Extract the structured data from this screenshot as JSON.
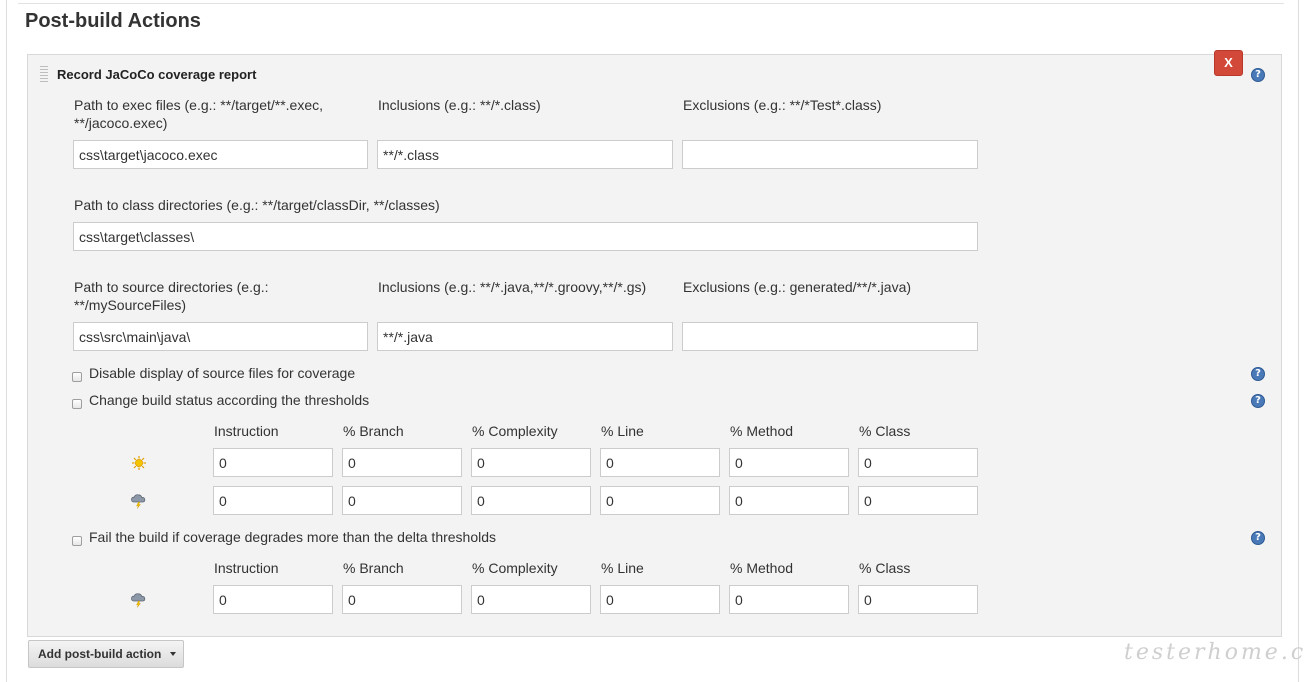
{
  "section_title": "Post-build Actions",
  "block": {
    "title": "Record JaCoCo coverage report",
    "delete_label": "X",
    "help_glyph": "?"
  },
  "exec": {
    "path_label_1": "Path to exec files (e.g.: **/target/**.exec,",
    "path_label_2": "**/jacoco.exec)",
    "path_value": "css\\target\\jacoco.exec",
    "inclusions_label": "Inclusions (e.g.: **/*.class)",
    "inclusions_value": "**/*.class",
    "exclusions_label": "Exclusions (e.g.: **/*Test*.class)",
    "exclusions_value": ""
  },
  "class_dirs": {
    "label": "Path to class directories (e.g.: **/target/classDir, **/classes)",
    "value": "css\\target\\classes\\"
  },
  "source": {
    "path_label_1": "Path to source directories (e.g.:",
    "path_label_2": "**/mySourceFiles)",
    "path_value": "css\\src\\main\\java\\",
    "inclusions_label": "Inclusions (e.g.: **/*.java,**/*.groovy,**/*.gs)",
    "inclusions_value": "**/*.java",
    "exclusions_label": "Exclusions (e.g.: generated/**/*.java)",
    "exclusions_value": ""
  },
  "options": {
    "disable_source": "Disable display of source files for coverage",
    "change_status": "Change build status according the thresholds",
    "fail_build": "Fail the build if coverage degrades more than the delta thresholds"
  },
  "threshold_headers": [
    "Instruction",
    "% Branch",
    "% Complexity",
    "% Line",
    "% Method",
    "% Class"
  ],
  "thresholds": {
    "sunny": [
      "0",
      "0",
      "0",
      "0",
      "0",
      "0"
    ],
    "stormy": [
      "0",
      "0",
      "0",
      "0",
      "0",
      "0"
    ]
  },
  "delta": {
    "values": [
      "0",
      "0",
      "0",
      "0",
      "0",
      "0"
    ]
  },
  "icons": {
    "sunny": "sun-icon",
    "stormy": "storm-icon",
    "help": "help-icon",
    "drag": "drag-handle-icon"
  },
  "footer": {
    "add_action": "Add post-build action"
  },
  "watermark": "testerhome.com",
  "colors": {
    "delete_button": "#d24939",
    "help_icon": "#4a79b8",
    "panel_bg": "#f3f3f3"
  }
}
